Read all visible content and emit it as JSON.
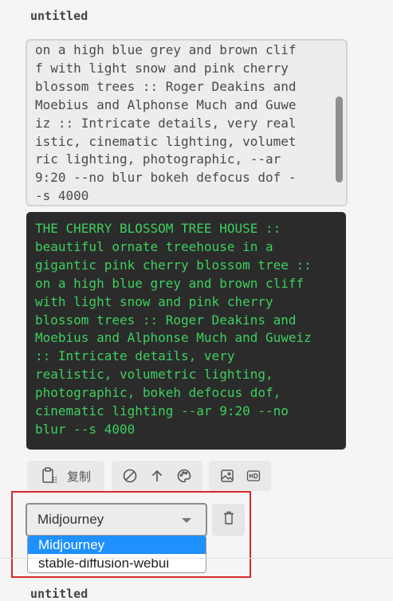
{
  "top_card": {
    "title": "untitled"
  },
  "input": {
    "lines": [
      "on a high blue grey and brown clif",
      "f with light snow and pink cherry",
      "blossom trees :: Roger Deakins and",
      "Moebius and Alphonse Much and Guwe",
      "iz :: Intricate details, very real",
      "istic, cinematic lighting, volumet",
      "ric lighting, photographic, --ar",
      "9:20 --no blur bokeh defocus dof -",
      "-s 4000"
    ]
  },
  "output": {
    "lines": [
      "THE CHERRY BLOSSOM TREE HOUSE ::",
      "beautiful ornate treehouse in a",
      "gigantic pink cherry blossom tree ::",
      "on a high blue grey and brown cliff",
      "with light snow and pink cherry",
      "blossom trees :: Roger Deakins and",
      "Moebius and Alphonse Much and Guweiz",
      ":: Intricate details, very",
      "realistic, volumetric lighting,",
      "photographic, bokeh defocus dof,",
      "cinematic lighting --ar 9:20 --no",
      "blur --s 4000"
    ]
  },
  "toolbar": {
    "copy_label": "复制",
    "icons": [
      "clipboard-icon",
      "clear-icon",
      "arrow-up-icon",
      "palette-icon",
      "image-icon",
      "hd-icon"
    ]
  },
  "model_select": {
    "selected": "Midjourney",
    "options": [
      "Midjourney",
      "stable-diffusion-webui"
    ],
    "delete_icon": "trash-icon"
  },
  "bottom_card": {
    "title": "untitled"
  },
  "colors": {
    "output_text": "#3ecf5f",
    "output_bg": "#2b2b2b",
    "highlight_border": "#d42b2b",
    "selected_option_bg": "#1e90ff"
  }
}
